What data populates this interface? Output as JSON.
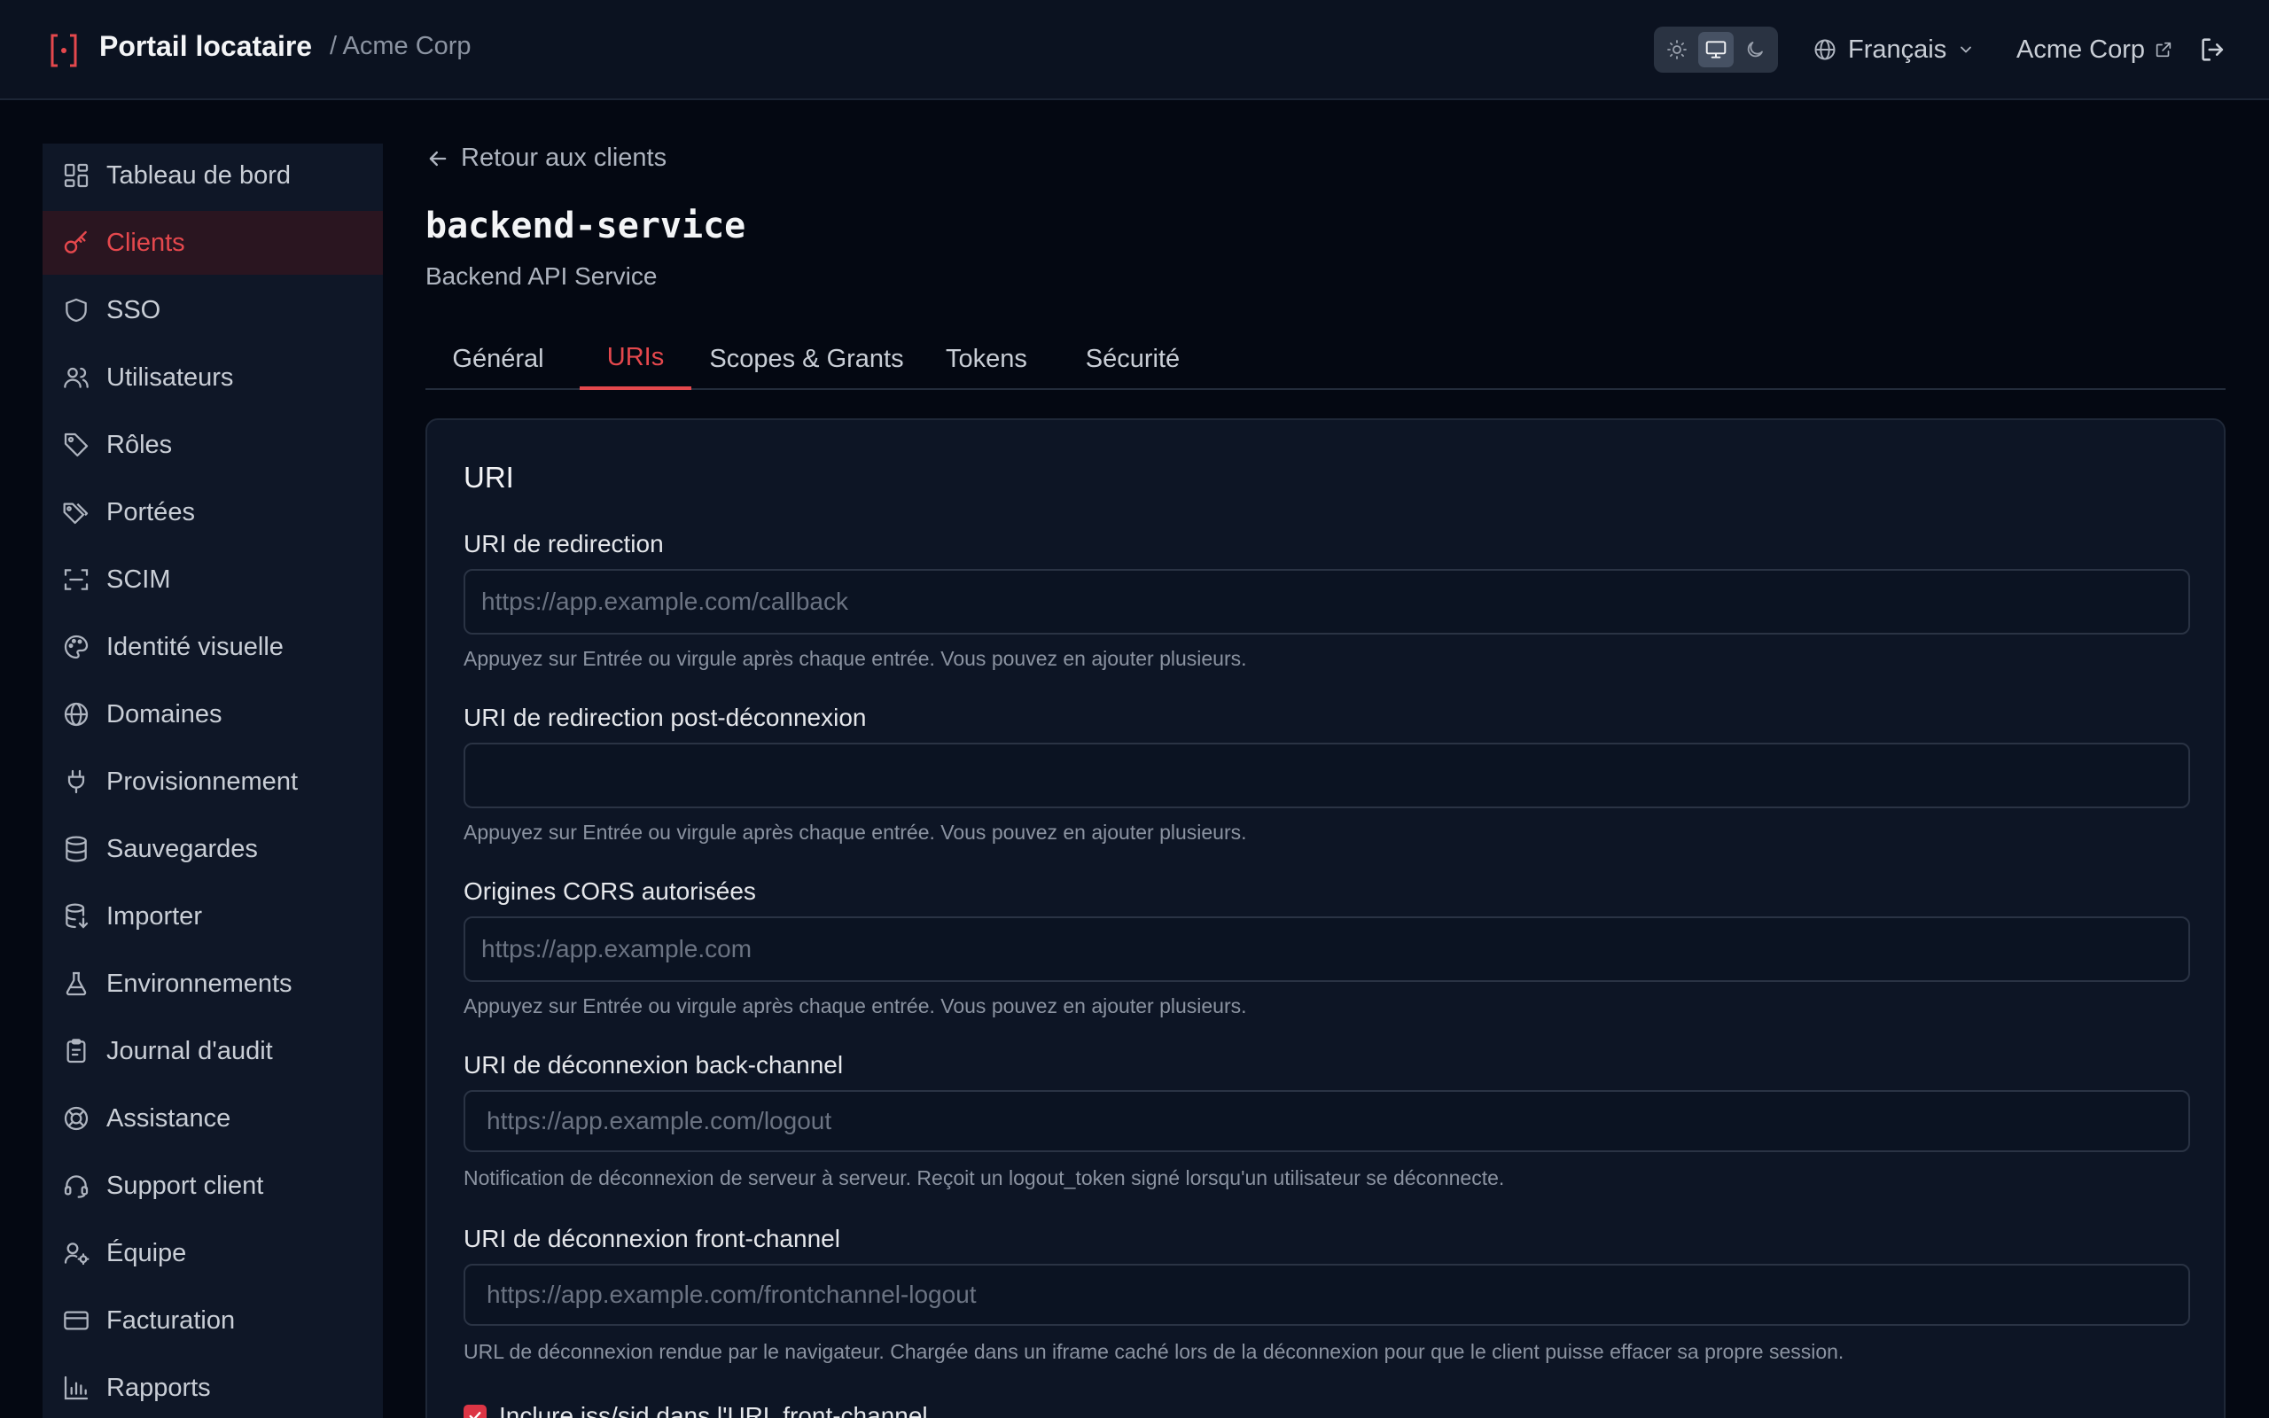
{
  "header": {
    "title": "Portail locataire",
    "breadcrumb": "/ Acme Corp",
    "theme_options": [
      "light-icon",
      "system-icon",
      "dark-icon"
    ],
    "theme_selected": "system",
    "language": "Français",
    "tenant_link": "Acme Corp"
  },
  "sidebar": {
    "items": [
      {
        "label": "Tableau de bord",
        "icon": "dashboard-icon"
      },
      {
        "label": "Clients",
        "icon": "key-icon",
        "active": true
      },
      {
        "label": "SSO",
        "icon": "shield-icon"
      },
      {
        "label": "Utilisateurs",
        "icon": "users-icon"
      },
      {
        "label": "Rôles",
        "icon": "tag-icon"
      },
      {
        "label": "Portées",
        "icon": "tags-icon"
      },
      {
        "label": "SCIM",
        "icon": "scan-icon"
      },
      {
        "label": "Identité visuelle",
        "icon": "palette-icon"
      },
      {
        "label": "Domaines",
        "icon": "globe-icon"
      },
      {
        "label": "Provisionnement",
        "icon": "plug-icon"
      },
      {
        "label": "Sauvegardes",
        "icon": "database-icon"
      },
      {
        "label": "Importer",
        "icon": "database-import-icon"
      },
      {
        "label": "Environnements",
        "icon": "flask-icon"
      },
      {
        "label": "Journal d'audit",
        "icon": "clipboard-icon"
      },
      {
        "label": "Assistance",
        "icon": "lifebuoy-icon"
      },
      {
        "label": "Support client",
        "icon": "headset-icon"
      },
      {
        "label": "Équipe",
        "icon": "user-cog-icon"
      },
      {
        "label": "Facturation",
        "icon": "credit-card-icon"
      },
      {
        "label": "Rapports",
        "icon": "bar-chart-icon"
      }
    ]
  },
  "main": {
    "back_label": "Retour aux clients",
    "client_name": "backend-service",
    "client_description": "Backend API Service",
    "tabs": [
      {
        "label": "Général"
      },
      {
        "label": "URIs",
        "active": true
      },
      {
        "label": "Scopes & Grants"
      },
      {
        "label": "Tokens"
      },
      {
        "label": "Sécurité"
      }
    ],
    "card": {
      "title": "URI",
      "fields": [
        {
          "label": "URI de redirection",
          "value": "",
          "placeholder": "https://app.example.com/callback",
          "help": "Appuyez sur Entrée ou virgule après chaque entrée. Vous pouvez en ajouter plusieurs."
        },
        {
          "label": "URI de redirection post-déconnexion",
          "value": "",
          "placeholder": "",
          "help": "Appuyez sur Entrée ou virgule après chaque entrée. Vous pouvez en ajouter plusieurs."
        },
        {
          "label": "Origines CORS autorisées",
          "value": "",
          "placeholder": "https://app.example.com",
          "help": "Appuyez sur Entrée ou virgule après chaque entrée. Vous pouvez en ajouter plusieurs."
        },
        {
          "label": "URI de déconnexion back-channel",
          "value": "",
          "placeholder": "https://app.example.com/logout",
          "help": "Notification de déconnexion de serveur à serveur. Reçoit un logout_token signé lorsqu'un utilisateur se déconnecte."
        },
        {
          "label": "URI de déconnexion front-channel",
          "value": "",
          "placeholder": "https://app.example.com/frontchannel-logout",
          "help": "URL de déconnexion rendue par le navigateur. Chargée dans un iframe caché lors de la déconnexion pour que le client puisse effacer sa propre session."
        }
      ],
      "checkbox": {
        "label": "Inclure iss/sid dans l'URL front-channel",
        "checked": true
      }
    }
  },
  "colors": {
    "accent": "#e5484d",
    "background": "#040812",
    "panel": "#0f1727"
  }
}
